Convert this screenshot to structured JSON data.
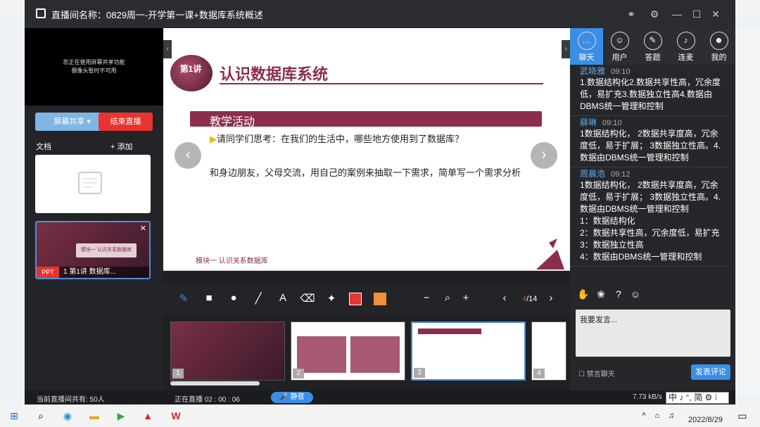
{
  "window": {
    "title": "直播间名称：0829周一-开学第一课+数据库系统概述"
  },
  "left": {
    "cam_notice_1": "您正在使用屏幕共享功能",
    "cam_notice_2": "摄像头暂时不可用",
    "share_label": "屏幕共享 ▾",
    "end_label": "结束直播",
    "docs_label": "文档",
    "add_label": "+ 添加",
    "ppt_tag": "PPT",
    "ppt_title": "1  第1讲 数据库...",
    "ppt_inner": "模块一 认识关系数据库"
  },
  "slide": {
    "badge": "第1讲",
    "title": "认识数据库系统",
    "activity": "教学活动",
    "question": "请同学们思考：在我们的生活中，哪些地方使用到了数据库？",
    "task": "和身边朋友，父母交流，用自己的案例来抽取一下需求，简单写一个需求分析",
    "footer": "模块一 认识关系数据库"
  },
  "toolbar": {
    "page_current": "4",
    "page_total": "/14"
  },
  "thumbs": [
    {
      "num": "1"
    },
    {
      "num": "2"
    },
    {
      "num": "3"
    },
    {
      "num": "4"
    }
  ],
  "chat": {
    "tabs": [
      {
        "label": "聊天",
        "icon": "chat-icon"
      },
      {
        "label": "用户",
        "icon": "users-icon"
      },
      {
        "label": "答题",
        "icon": "pen-icon"
      },
      {
        "label": "连麦",
        "icon": "mic-icon"
      },
      {
        "label": "我的",
        "icon": "profile-icon"
      }
    ],
    "messages": [
      {
        "name": "武晓雅",
        "time": "09:10",
        "text": "1.数据结构化2.数据共享性高，冗余度低，易扩充3.数据独立性高4.数据由DBMS统一管理和控制"
      },
      {
        "name": "薛琳",
        "time": "09:10",
        "text": "1数据结构化， 2数据共享度高，冗余度低，易于扩展； 3数据独立性高。4.数据由DBMS统一管理和控制"
      },
      {
        "name": "周晨浩",
        "time": "09:12",
        "text": "1数据结构化， 2数据共享度高，冗余度低，易于扩展； 3数据独立性高。4.数据由DBMS统一管理和控制\n1：数据结构化\n2：数据共享性高，冗余度低，易扩充\n3：数据独立性高\n4：数据由DBMS统一管理和控制"
      }
    ],
    "input_placeholder": "我要发言...",
    "mute_label": "禁言聊天",
    "send_label": "发表评论"
  },
  "status": {
    "viewers": "当前直播间共有: 50人",
    "live": "正在直播 02 : 00 : 06",
    "mute": "静音",
    "speed": "7.73 kB/s"
  },
  "taskbar": {
    "date": "2022/8/29",
    "ime": "中 ♪ °, 简 ⚙ ⁝"
  }
}
